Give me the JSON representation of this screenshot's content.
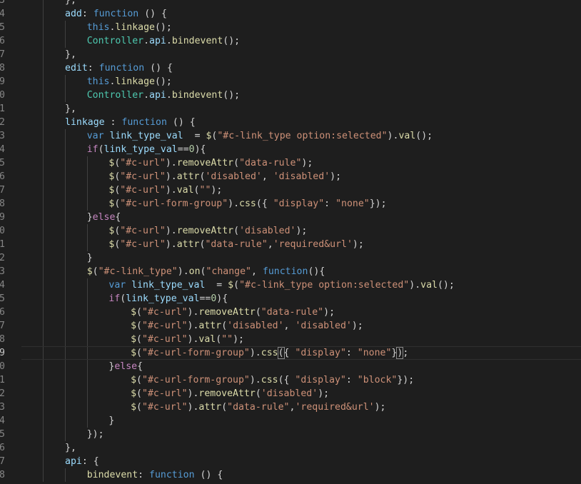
{
  "editor": {
    "colors": {
      "background": "#1e1e1e",
      "plain": "#d4d4d4",
      "keyword": "#569cd6",
      "function": "#dcdcaa",
      "variable": "#9cdcfe",
      "class": "#4ec9b0",
      "string": "#ce9178",
      "number": "#b5cea8",
      "control": "#c586c0",
      "line_number": "#858585"
    },
    "current_line_index": 26,
    "gutter_line_numbers": [
      "3",
      "4",
      "5",
      "6",
      "7",
      "8",
      "9",
      "0",
      "1",
      "2",
      "3",
      "4",
      "5",
      "6",
      "7",
      "8",
      "9",
      "0",
      "1",
      "2",
      "3",
      "4",
      "5",
      "6",
      "7",
      "8",
      "9",
      "0",
      "1",
      "2",
      "3",
      "4",
      "5",
      "6",
      "7",
      "8"
    ],
    "lines": [
      {
        "indent": 2,
        "tokens": [
          [
            "},",
            "p"
          ]
        ]
      },
      {
        "indent": 2,
        "tokens": [
          [
            "add",
            "v"
          ],
          [
            ": ",
            "p"
          ],
          [
            "function",
            "k"
          ],
          [
            " () {",
            "p"
          ]
        ]
      },
      {
        "indent": 3,
        "tokens": [
          [
            "this",
            "k"
          ],
          [
            ".",
            "p"
          ],
          [
            "linkage",
            "f"
          ],
          [
            "();",
            "p"
          ]
        ]
      },
      {
        "indent": 3,
        "tokens": [
          [
            "Controller",
            "c"
          ],
          [
            ".",
            "p"
          ],
          [
            "api",
            "v"
          ],
          [
            ".",
            "p"
          ],
          [
            "bindevent",
            "f"
          ],
          [
            "();",
            "p"
          ]
        ]
      },
      {
        "indent": 2,
        "tokens": [
          [
            "},",
            "p"
          ]
        ]
      },
      {
        "indent": 2,
        "tokens": [
          [
            "edit",
            "v"
          ],
          [
            ": ",
            "p"
          ],
          [
            "function",
            "k"
          ],
          [
            " () {",
            "p"
          ]
        ]
      },
      {
        "indent": 3,
        "tokens": [
          [
            "this",
            "k"
          ],
          [
            ".",
            "p"
          ],
          [
            "linkage",
            "f"
          ],
          [
            "();",
            "p"
          ]
        ]
      },
      {
        "indent": 3,
        "tokens": [
          [
            "Controller",
            "c"
          ],
          [
            ".",
            "p"
          ],
          [
            "api",
            "v"
          ],
          [
            ".",
            "p"
          ],
          [
            "bindevent",
            "f"
          ],
          [
            "();",
            "p"
          ]
        ]
      },
      {
        "indent": 2,
        "tokens": [
          [
            "},",
            "p"
          ]
        ]
      },
      {
        "indent": 2,
        "tokens": [
          [
            "linkage",
            "v"
          ],
          [
            " : ",
            "p"
          ],
          [
            "function",
            "k"
          ],
          [
            " () {",
            "p"
          ]
        ]
      },
      {
        "indent": 3,
        "tokens": [
          [
            "var",
            "k"
          ],
          [
            " ",
            "p"
          ],
          [
            "link_type_val",
            "v"
          ],
          [
            "  = ",
            "p"
          ],
          [
            "$",
            "f"
          ],
          [
            "(",
            "p"
          ],
          [
            "\"#c-link_type option:selected\"",
            "s"
          ],
          [
            ").",
            "p"
          ],
          [
            "val",
            "f"
          ],
          [
            "();",
            "p"
          ]
        ]
      },
      {
        "indent": 3,
        "tokens": [
          [
            "if",
            "ctl"
          ],
          [
            "(",
            "p"
          ],
          [
            "link_type_val",
            "v"
          ],
          [
            "==",
            "p"
          ],
          [
            "0",
            "n"
          ],
          [
            "){",
            "p"
          ]
        ]
      },
      {
        "indent": 4,
        "tokens": [
          [
            "$",
            "f"
          ],
          [
            "(",
            "p"
          ],
          [
            "\"#c-url\"",
            "s"
          ],
          [
            ").",
            "p"
          ],
          [
            "removeAttr",
            "f"
          ],
          [
            "(",
            "p"
          ],
          [
            "\"data-rule\"",
            "s"
          ],
          [
            ");",
            "p"
          ]
        ]
      },
      {
        "indent": 4,
        "tokens": [
          [
            "$",
            "f"
          ],
          [
            "(",
            "p"
          ],
          [
            "\"#c-url\"",
            "s"
          ],
          [
            ").",
            "p"
          ],
          [
            "attr",
            "f"
          ],
          [
            "(",
            "p"
          ],
          [
            "'disabled'",
            "s"
          ],
          [
            ", ",
            "p"
          ],
          [
            "'disabled'",
            "s"
          ],
          [
            ");",
            "p"
          ]
        ]
      },
      {
        "indent": 4,
        "tokens": [
          [
            "$",
            "f"
          ],
          [
            "(",
            "p"
          ],
          [
            "\"#c-url\"",
            "s"
          ],
          [
            ").",
            "p"
          ],
          [
            "val",
            "f"
          ],
          [
            "(",
            "p"
          ],
          [
            "\"\"",
            "s"
          ],
          [
            ");",
            "p"
          ]
        ]
      },
      {
        "indent": 4,
        "tokens": [
          [
            "$",
            "f"
          ],
          [
            "(",
            "p"
          ],
          [
            "\"#c-url-form-group\"",
            "s"
          ],
          [
            ").",
            "p"
          ],
          [
            "css",
            "f"
          ],
          [
            "({ ",
            "p"
          ],
          [
            "\"display\"",
            "s"
          ],
          [
            ": ",
            "p"
          ],
          [
            "\"none\"",
            "s"
          ],
          [
            "});",
            "p"
          ]
        ]
      },
      {
        "indent": 3,
        "tokens": [
          [
            "}",
            "p"
          ],
          [
            "else",
            "ctl"
          ],
          [
            "{",
            "p"
          ]
        ]
      },
      {
        "indent": 4,
        "tokens": [
          [
            "$",
            "f"
          ],
          [
            "(",
            "p"
          ],
          [
            "\"#c-url\"",
            "s"
          ],
          [
            ").",
            "p"
          ],
          [
            "removeAttr",
            "f"
          ],
          [
            "(",
            "p"
          ],
          [
            "'disabled'",
            "s"
          ],
          [
            ");",
            "p"
          ]
        ]
      },
      {
        "indent": 4,
        "tokens": [
          [
            "$",
            "f"
          ],
          [
            "(",
            "p"
          ],
          [
            "\"#c-url\"",
            "s"
          ],
          [
            ").",
            "p"
          ],
          [
            "attr",
            "f"
          ],
          [
            "(",
            "p"
          ],
          [
            "\"data-rule\"",
            "s"
          ],
          [
            ",",
            "p"
          ],
          [
            "'required&url'",
            "s"
          ],
          [
            ");",
            "p"
          ]
        ]
      },
      {
        "indent": 3,
        "tokens": [
          [
            "}",
            "p"
          ]
        ]
      },
      {
        "indent": 3,
        "tokens": [
          [
            "$",
            "f"
          ],
          [
            "(",
            "p"
          ],
          [
            "\"#c-link_type\"",
            "s"
          ],
          [
            ").",
            "p"
          ],
          [
            "on",
            "f"
          ],
          [
            "(",
            "p"
          ],
          [
            "\"change\"",
            "s"
          ],
          [
            ", ",
            "p"
          ],
          [
            "function",
            "k"
          ],
          [
            "(){",
            "p"
          ]
        ]
      },
      {
        "indent": 4,
        "tokens": [
          [
            "var",
            "k"
          ],
          [
            " ",
            "p"
          ],
          [
            "link_type_val",
            "v"
          ],
          [
            "  = ",
            "p"
          ],
          [
            "$",
            "f"
          ],
          [
            "(",
            "p"
          ],
          [
            "\"#c-link_type option:selected\"",
            "s"
          ],
          [
            ").",
            "p"
          ],
          [
            "val",
            "f"
          ],
          [
            "();",
            "p"
          ]
        ]
      },
      {
        "indent": 4,
        "tokens": [
          [
            "if",
            "ctl"
          ],
          [
            "(",
            "p"
          ],
          [
            "link_type_val",
            "v"
          ],
          [
            "==",
            "p"
          ],
          [
            "0",
            "n"
          ],
          [
            "){",
            "p"
          ]
        ]
      },
      {
        "indent": 5,
        "tokens": [
          [
            "$",
            "f"
          ],
          [
            "(",
            "p"
          ],
          [
            "\"#c-url\"",
            "s"
          ],
          [
            ").",
            "p"
          ],
          [
            "removeAttr",
            "f"
          ],
          [
            "(",
            "p"
          ],
          [
            "\"data-rule\"",
            "s"
          ],
          [
            ");",
            "p"
          ]
        ]
      },
      {
        "indent": 5,
        "tokens": [
          [
            "$",
            "f"
          ],
          [
            "(",
            "p"
          ],
          [
            "\"#c-url\"",
            "s"
          ],
          [
            ").",
            "p"
          ],
          [
            "attr",
            "f"
          ],
          [
            "(",
            "p"
          ],
          [
            "'disabled'",
            "s"
          ],
          [
            ", ",
            "p"
          ],
          [
            "'disabled'",
            "s"
          ],
          [
            ");",
            "p"
          ]
        ]
      },
      {
        "indent": 5,
        "tokens": [
          [
            "$",
            "f"
          ],
          [
            "(",
            "p"
          ],
          [
            "\"#c-url\"",
            "s"
          ],
          [
            ").",
            "p"
          ],
          [
            "val",
            "f"
          ],
          [
            "(",
            "p"
          ],
          [
            "\"\"",
            "s"
          ],
          [
            ");",
            "p"
          ]
        ]
      },
      {
        "indent": 5,
        "tokens": [
          [
            "$",
            "f"
          ],
          [
            "(",
            "p"
          ],
          [
            "\"#c-url-form-group\"",
            "s"
          ],
          [
            ").",
            "p"
          ],
          [
            "css",
            "f"
          ],
          [
            "(",
            "bm"
          ],
          [
            "{ ",
            "p"
          ],
          [
            "\"display\"",
            "s"
          ],
          [
            ": ",
            "p"
          ],
          [
            "\"none\"",
            "s"
          ],
          [
            "}",
            "p"
          ],
          [
            ")",
            "bm"
          ],
          [
            ";",
            "p"
          ]
        ]
      },
      {
        "indent": 4,
        "tokens": [
          [
            "}",
            "p"
          ],
          [
            "else",
            "ctl"
          ],
          [
            "{",
            "p"
          ]
        ]
      },
      {
        "indent": 5,
        "tokens": [
          [
            "$",
            "f"
          ],
          [
            "(",
            "p"
          ],
          [
            "\"#c-url-form-group\"",
            "s"
          ],
          [
            ").",
            "p"
          ],
          [
            "css",
            "f"
          ],
          [
            "({ ",
            "p"
          ],
          [
            "\"display\"",
            "s"
          ],
          [
            ": ",
            "p"
          ],
          [
            "\"block\"",
            "s"
          ],
          [
            "});",
            "p"
          ]
        ]
      },
      {
        "indent": 5,
        "tokens": [
          [
            "$",
            "f"
          ],
          [
            "(",
            "p"
          ],
          [
            "\"#c-url\"",
            "s"
          ],
          [
            ").",
            "p"
          ],
          [
            "removeAttr",
            "f"
          ],
          [
            "(",
            "p"
          ],
          [
            "'disabled'",
            "s"
          ],
          [
            ");",
            "p"
          ]
        ]
      },
      {
        "indent": 5,
        "tokens": [
          [
            "$",
            "f"
          ],
          [
            "(",
            "p"
          ],
          [
            "\"#c-url\"",
            "s"
          ],
          [
            ").",
            "p"
          ],
          [
            "attr",
            "f"
          ],
          [
            "(",
            "p"
          ],
          [
            "\"data-rule\"",
            "s"
          ],
          [
            ",",
            "p"
          ],
          [
            "'required&url'",
            "s"
          ],
          [
            ");",
            "p"
          ]
        ]
      },
      {
        "indent": 4,
        "tokens": [
          [
            "}",
            "p"
          ]
        ]
      },
      {
        "indent": 3,
        "tokens": [
          [
            "});",
            "p"
          ]
        ]
      },
      {
        "indent": 2,
        "tokens": [
          [
            "},",
            "p"
          ]
        ]
      },
      {
        "indent": 2,
        "tokens": [
          [
            "api",
            "v"
          ],
          [
            ": {",
            "p"
          ]
        ]
      },
      {
        "indent": 3,
        "tokens": [
          [
            "bindevent",
            "f"
          ],
          [
            ": ",
            "p"
          ],
          [
            "function",
            "k"
          ],
          [
            " () {",
            "p"
          ]
        ]
      }
    ]
  }
}
